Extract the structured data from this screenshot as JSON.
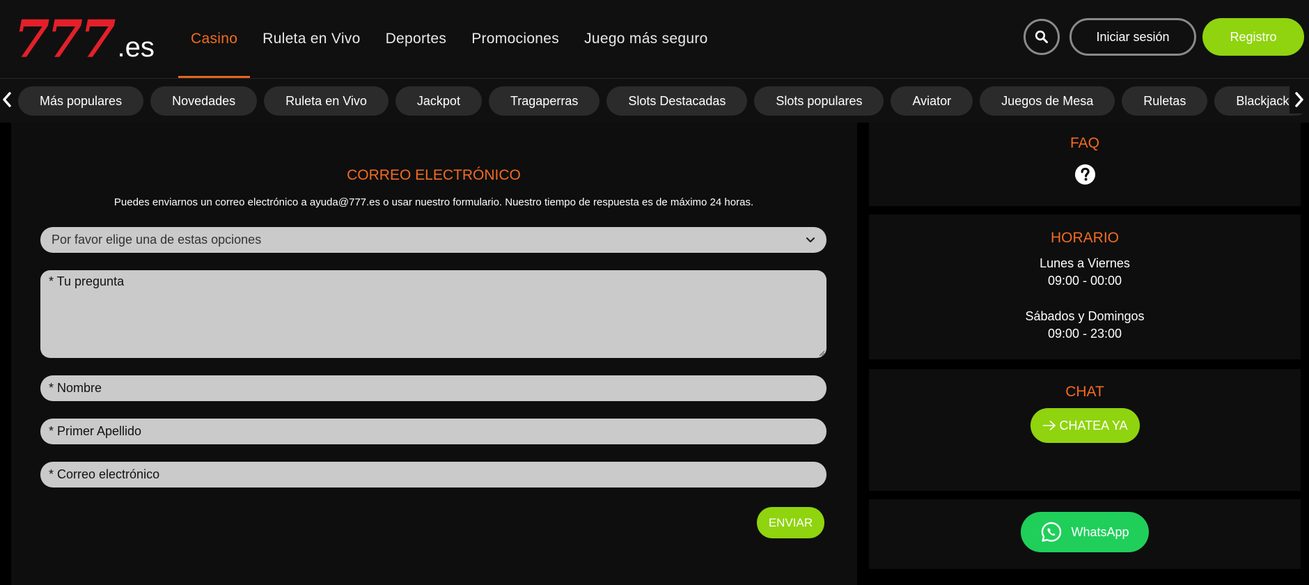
{
  "header": {
    "logo": {
      "number": "777",
      "tld": ".es"
    },
    "nav": [
      {
        "label": "Casino",
        "active": true
      },
      {
        "label": "Ruleta en Vivo",
        "active": false
      },
      {
        "label": "Deportes",
        "active": false
      },
      {
        "label": "Promociones",
        "active": false
      },
      {
        "label": "Juego más seguro",
        "active": false
      }
    ],
    "search_icon": "search-icon",
    "login_label": "Iniciar sesión",
    "register_label": "Registro"
  },
  "categories": [
    "Más populares",
    "Novedades",
    "Ruleta en Vivo",
    "Jackpot",
    "Tragaperras",
    "Slots Destacadas",
    "Slots populares",
    "Aviator",
    "Juegos de Mesa",
    "Ruletas",
    "Blackjack"
  ],
  "form": {
    "title": "CORREO ELECTRÓNICO",
    "description": "Puedes enviarnos un correo electrónico a ayuda@777.es o usar nuestro formulario. Nuestro tiempo de respuesta es de máximo 24 horas.",
    "select_placeholder": "Por favor elige una de estas opciones",
    "question_placeholder": "* Tu pregunta",
    "name_placeholder": "* Nombre",
    "surname_placeholder": "* Primer Apellido",
    "email_placeholder": "* Correo electrónico",
    "submit_label": "ENVIAR"
  },
  "sidebar": {
    "faq": {
      "title": "FAQ",
      "icon": "question-circle-icon"
    },
    "schedule": {
      "title": "HORARIO",
      "weekdays_label": "Lunes a Viernes",
      "weekdays_hours": "09:00 - 00:00",
      "weekend_label": "Sábados y Domingos",
      "weekend_hours": "09:00 - 23:00"
    },
    "chat": {
      "title": "CHAT",
      "button_label": "CHATEA YA",
      "icon": "arrow-right-icon"
    },
    "whatsapp": {
      "button_label": "WhatsApp",
      "icon": "whatsapp-icon"
    }
  },
  "colors": {
    "accent_orange": "#f26b21",
    "accent_green": "#8fd40e",
    "whatsapp_green": "#1fcf5a",
    "logo_red": "#e2202a"
  }
}
